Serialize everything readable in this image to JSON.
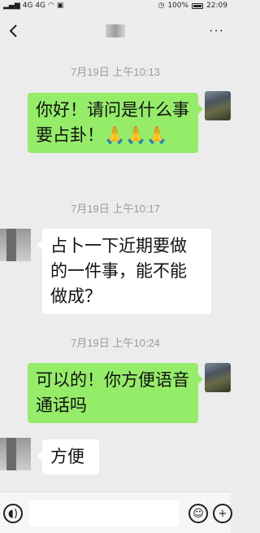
{
  "status_bar": {
    "left_signals": "4G 4G",
    "battery_text": "100%",
    "time": "22:09"
  },
  "nav": {
    "back_icon": "chevron-left-icon",
    "more_label": "···"
  },
  "messages": [
    {
      "timestamp": "7月19日 上午10:13",
      "direction": "out",
      "text": "你好！请问是什么事要占卦！🙏🙏🙏"
    },
    {
      "timestamp": "7月19日 上午10:17",
      "direction": "in",
      "text": "占卜一下近期要做的一件事，能不能做成？"
    },
    {
      "timestamp": "7月19日 上午10:24",
      "direction": "out",
      "text": "可以的！你方便语音通话吗"
    },
    {
      "timestamp": "",
      "direction": "in",
      "text": "方便"
    }
  ],
  "input_bar": {
    "voice_icon": "voice-icon",
    "emoji_icon": "emoji-icon",
    "plus_icon": "plus-icon"
  }
}
